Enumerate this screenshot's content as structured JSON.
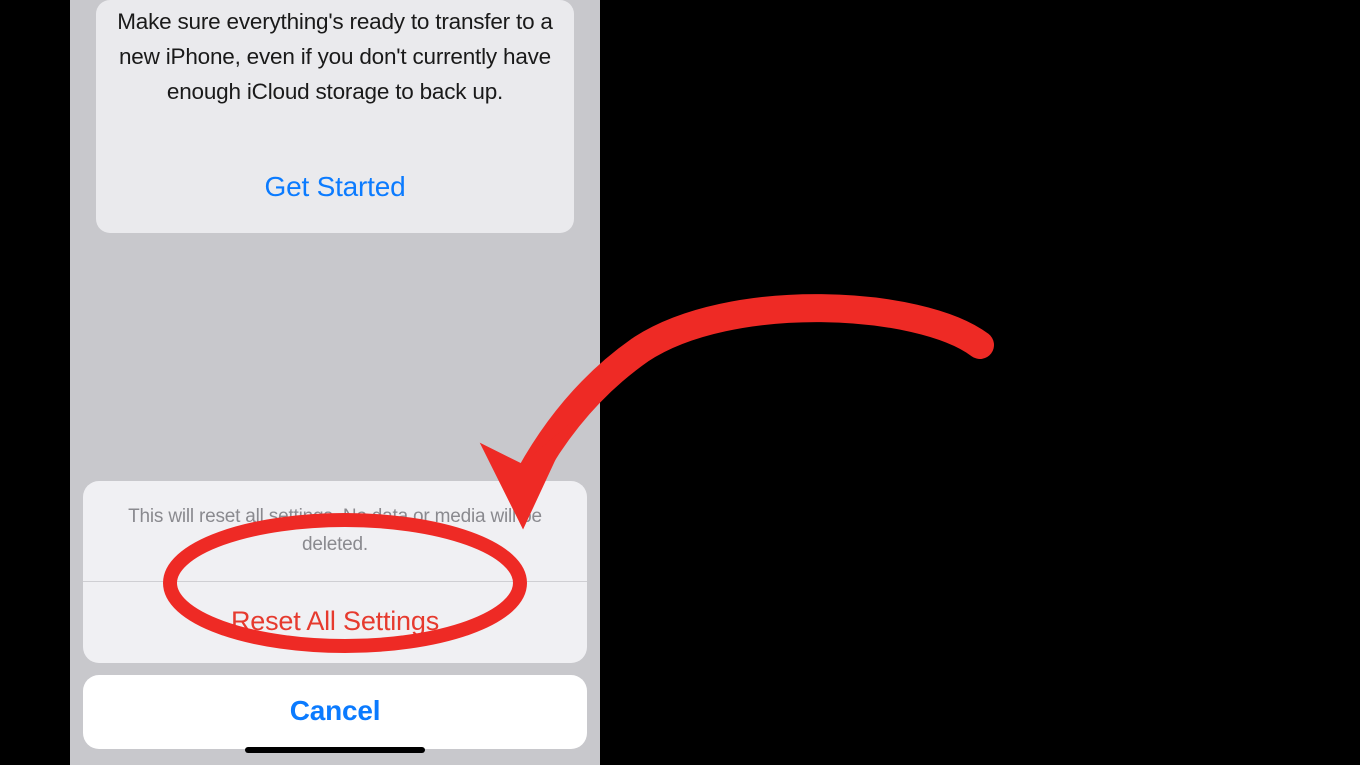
{
  "card": {
    "description": "Make sure everything's ready to transfer to a new iPhone, even if you don't currently have enough iCloud storage to back up.",
    "primary_action": "Get Started"
  },
  "sheet": {
    "message": "This will reset all settings. No data or media will be deleted.",
    "destructive_action": "Reset All Settings",
    "cancel_label": "Cancel"
  },
  "annotation": {
    "color": "#ee2a25"
  }
}
